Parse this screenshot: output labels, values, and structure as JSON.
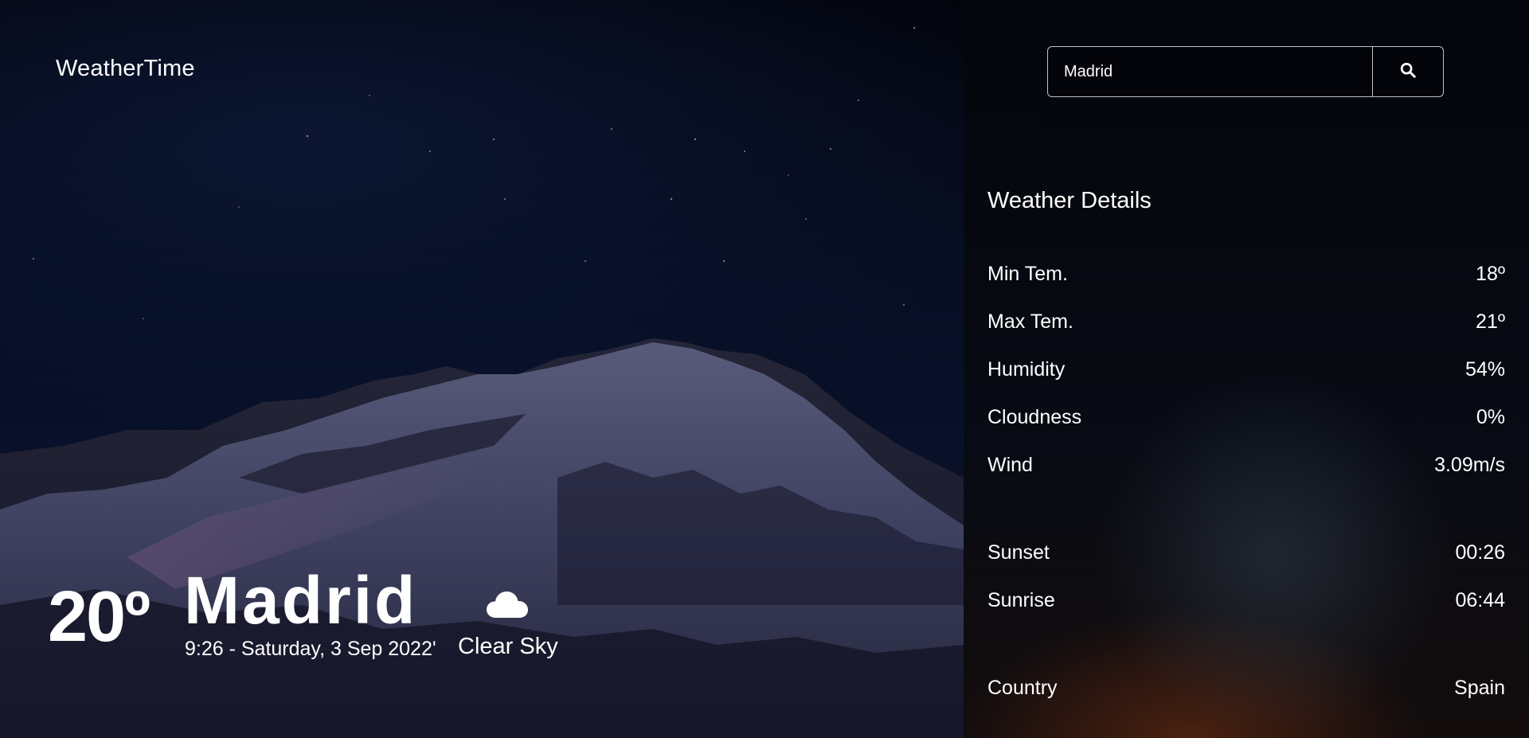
{
  "app": {
    "logo": "WeatherTime"
  },
  "search": {
    "value": "Madrid",
    "placeholder": "",
    "icon": "search-icon"
  },
  "current": {
    "temperature": "20º",
    "city": "Madrid",
    "datetime": "9:26 - Saturday, 3 Sep 2022'",
    "condition": "Clear Sky",
    "condition_icon": "cloud-icon"
  },
  "details": {
    "title": "Weather Details",
    "rows": [
      {
        "label": "Min Tem.",
        "value": "18º"
      },
      {
        "label": "Max Tem.",
        "value": "21º"
      },
      {
        "label": "Humidity",
        "value": "54%"
      },
      {
        "label": "Cloudness",
        "value": "0%"
      },
      {
        "label": "Wind",
        "value": "3.09m/s"
      },
      {
        "label": "Sunset",
        "value": "00:26"
      },
      {
        "label": "Sunrise",
        "value": "06:44"
      },
      {
        "label": "Country",
        "value": "Spain"
      }
    ]
  }
}
